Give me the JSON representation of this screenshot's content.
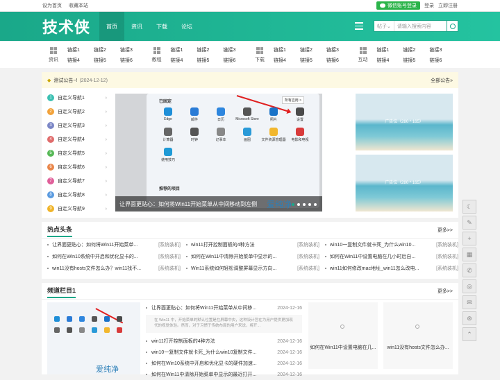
{
  "topbar": {
    "set_home": "设为首页",
    "favorite": "收藏本站",
    "wechat_login": "微信账号登录",
    "login": "登录",
    "register": "立即注册"
  },
  "header": {
    "logo": "技术侠",
    "nav": [
      "首页",
      "资讯",
      "下载",
      "论坛"
    ],
    "search_type": "帖子",
    "search_placeholder": "请输入搜索内容"
  },
  "subnav": [
    {
      "label": "资讯",
      "links": [
        "链接1",
        "链接2",
        "链接3",
        "链接4",
        "链接5",
        "链接6"
      ]
    },
    {
      "label": "教程",
      "links": [
        "链接1",
        "链接2",
        "链接3",
        "链接4",
        "链接5",
        "链接6"
      ]
    },
    {
      "label": "下载",
      "links": [
        "链接1",
        "链接2",
        "链接3",
        "链接4",
        "链接5",
        "链接6"
      ]
    },
    {
      "label": "互动",
      "links": [
        "链接1",
        "链接2",
        "链接3",
        "链接4",
        "链接5",
        "链接6"
      ]
    }
  ],
  "notice": {
    "text": "测试公告~!",
    "date": "(2024-12-12)",
    "all": "全部公告»"
  },
  "guide": {
    "items": [
      "自定义导航1",
      "自定义导航2",
      "自定义导航3",
      "自定义导航4",
      "自定义导航5",
      "自定义导航6",
      "自定义导航7",
      "自定义导航8",
      "自定义导航9"
    ],
    "colors": [
      "#3cc0b2",
      "#f2a23a",
      "#7b86c6",
      "#e06c6c",
      "#57b957",
      "#e9864a",
      "#e0609a",
      "#5a9be0",
      "#f0b429"
    ]
  },
  "slider": {
    "pinned": "已固定",
    "all_apps": "所有应用 >",
    "apps": [
      "Edge",
      "邮件",
      "日历",
      "Microsoft Store",
      "照片",
      "设置",
      "计算器",
      "时钟",
      "记事本",
      "画图",
      "文件资源管理器",
      "电影和电视",
      "使用技巧"
    ],
    "recommended": "推荐的项目",
    "caption": "让界面更贴心：如何将Win11开始菜单从中间移动到左侧",
    "watermark": "爱纯净",
    "ad_label": "广告位（280 * 165）"
  },
  "hot": {
    "title": "热点头条",
    "more": "更多>>",
    "items": [
      {
        "t": "让界面更贴心：如何将Win11开始菜单...",
        "c": "[系统装机]"
      },
      {
        "t": "win11打开控制面板的4种方法",
        "c": "[系统装机]"
      },
      {
        "t": "win10一复制文件就卡死_为什么win10...",
        "c": "[系统装机]"
      },
      {
        "t": "如何在Win10系统中开启和优化显卡的...",
        "c": "[系统装机]"
      },
      {
        "t": "如何在Win11中清除开始菜单中显示的...",
        "c": "[系统装机]"
      },
      {
        "t": "如何在Win11中设置电脑在几小时后自...",
        "c": "[系统装机]"
      },
      {
        "t": "win11没有hosts文件怎么办？win11找不...",
        "c": "[系统装机]"
      },
      {
        "t": "Win11系统如何轻松调整屏幕显示方向...",
        "c": "[系统装机]"
      },
      {
        "t": "win11如何修改mac地址_win11怎么改电...",
        "c": "[系统装机]"
      }
    ]
  },
  "channel": {
    "title": "频道栏目1",
    "more": "更多>>",
    "list": [
      {
        "t": "让界面更贴心：如何将Win11开始菜单从中间移...",
        "d": "2024-12-16"
      },
      {
        "t": "win11打开控制面板的4种方法",
        "d": "2024-12-16"
      },
      {
        "t": "win10一复制文件就卡死_为什么win10复制文件...",
        "d": "2024-12-16"
      },
      {
        "t": "如何在Win10系统中开启和优化显卡的硬件加速...",
        "d": "2024-12-16"
      },
      {
        "t": "如何在Win11中清除开始菜单中显示的最近打开...",
        "d": "2024-12-16"
      }
    ],
    "summary": "在 Win11 中，开始菜单的默认位置是在屏幕中央，这种设计旨在为用户提供更加现代的视觉体验。然而，对于习惯于传统布局的用户来说，将开...",
    "cards": [
      "如何在Win11中设置电脑在几...",
      "win11没有hosts文件怎么办..."
    ]
  },
  "sidebar": {
    "icons": [
      "moon-icon",
      "edit-icon",
      "plus-icon",
      "calendar-icon",
      "phone-icon",
      "qq-icon",
      "wechat-icon",
      "weibo-icon",
      "top-icon"
    ],
    "glyphs": [
      "☾",
      "✎",
      "+",
      "▦",
      "✆",
      "◎",
      "✉",
      "⊛",
      "⌃"
    ]
  }
}
